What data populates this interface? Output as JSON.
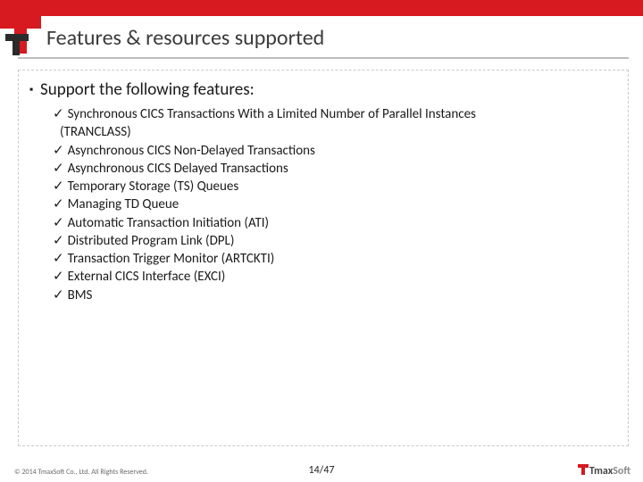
{
  "title": "Features & resources supported",
  "heading": "Support the following features:",
  "items": [
    "Synchronous CICS Transactions With a Limited Number of Parallel Instances",
    "Asynchronous CICS Non-Delayed Transactions",
    "Asynchronous CICS Delayed Transactions",
    "Temporary Storage (TS) Queues",
    "Managing TD Queue",
    "Automatic Transaction Initiation (ATI)",
    "Distributed Program Link (DPL)",
    "Transaction Trigger Monitor (ARTCKTI)",
    "External CICS Interface (EXCI)",
    "BMS"
  ],
  "item0_continuation": "(TRANCLASS)",
  "copyright": "© 2014 TmaxSoft Co., Ltd. All Rights Reserved.",
  "page": "14/47",
  "footer_brand_main": "Tmax",
  "footer_brand_soft": "Soft"
}
